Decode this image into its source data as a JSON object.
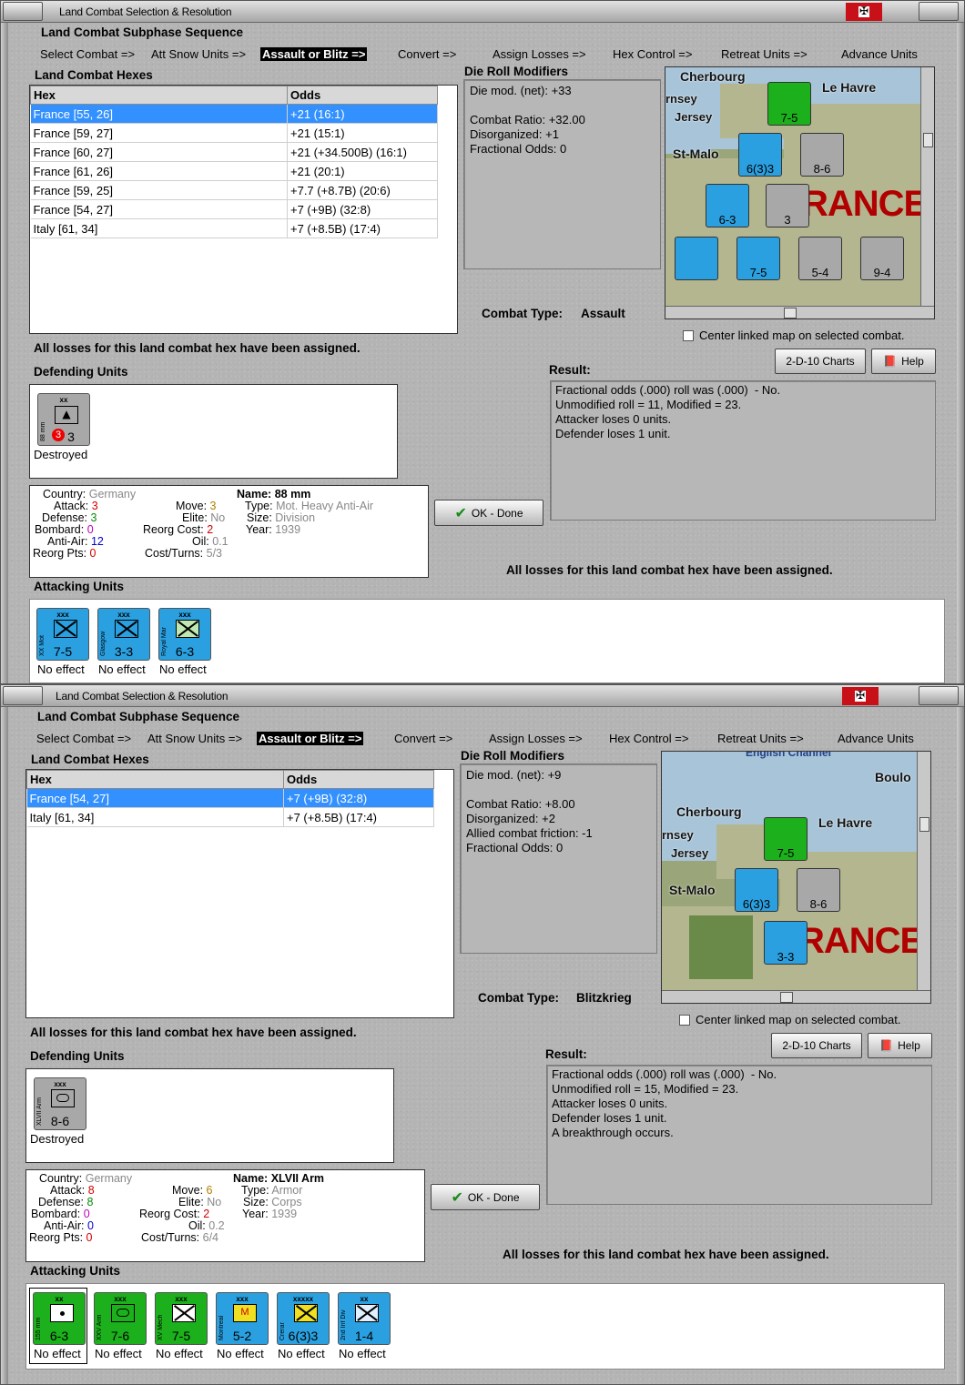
{
  "windows": [
    {
      "title": "Land Combat Selection & Resolution",
      "sequence_header": "Land Combat Subphase Sequence",
      "sequence": [
        "Select Combat =>",
        "Att Snow Units =>",
        "Assault or Blitz =>",
        "Convert =>",
        "Assign Losses =>",
        "Hex Control =>",
        "Retreat Units =>",
        "Advance Units"
      ],
      "hexes_header": "Land Combat Hexes",
      "hex_col": "Hex",
      "odds_col": "Odds",
      "hexes": [
        {
          "hex": "France [55, 26]",
          "odds": "+21 (16:1)"
        },
        {
          "hex": "France [59, 27]",
          "odds": "+21 (15:1)"
        },
        {
          "hex": "France [60, 27]",
          "odds": "+21 (+34.500B) (16:1)"
        },
        {
          "hex": "France [61, 26]",
          "odds": "+21 (20:1)"
        },
        {
          "hex": "France [59, 25]",
          "odds": "+7.7 (+8.7B) (20:6)"
        },
        {
          "hex": "France [54, 27]",
          "odds": "+7 (+9B) (32:8)"
        },
        {
          "hex": "Italy [61, 34]",
          "odds": "+7 (+8.5B) (17:4)"
        }
      ],
      "drm_header": "Die Roll Modifiers",
      "drm_text": "Die mod. (net): +33\n\nCombat Ratio: +32.00\nDisorganized: +1\nFractional Odds: 0",
      "combat_type_label": "Combat Type:",
      "combat_type": "Assault",
      "center_map": "Center linked map on selected combat.",
      "charts_btn": "2-D-10 Charts",
      "help_btn": "Help",
      "losses_msg": "All losses for this land combat hex have been assigned.",
      "defending_header": "Defending Units",
      "defender": {
        "top": "xx",
        "side": "88 mm",
        "value": "3",
        "badge": "3",
        "status": "Destroyed"
      },
      "result_header": "Result:",
      "result_text": "Fractional odds (.000) roll was (.000)  - No.\nUnmodified roll = 11, Modified = 23.\nAttacker loses 0 units.\nDefender loses 1 unit.",
      "ok_btn": "OK - Done",
      "info": {
        "country_k": "Country:",
        "country": "Germany",
        "attack_k": "Attack:",
        "attack": "3",
        "defense_k": "Defense:",
        "defense": "3",
        "bombard_k": "Bombard:",
        "bombard": "0",
        "antiair_k": "Anti-Air:",
        "antiair": "12",
        "reorgpts_k": "Reorg Pts:",
        "reorgpts": "0",
        "move_k": "Move:",
        "move": "3",
        "elite_k": "Elite:",
        "elite": "No",
        "reorgcost_k": "Reorg Cost:",
        "reorgcost": "2",
        "oil_k": "Oil:",
        "oil": "0.1",
        "costturns_k": "Cost/Turns:",
        "costturns": "5/3",
        "name_k": "Name:",
        "name": "88 mm",
        "type_k": "Type:",
        "type": "Mot. Heavy Anti-Air",
        "size_k": "Size:",
        "size": "Division",
        "year_k": "Year:",
        "year": "1939"
      },
      "attacking_header": "Attacking Units",
      "attackers": [
        {
          "top": "xxx",
          "side": "XX Mot",
          "value": "7-5",
          "status": "No effect",
          "color": "#2aa0e0"
        },
        {
          "top": "xxx",
          "side": "Glasgow",
          "value": "3-3",
          "status": "No effect",
          "color": "#2aa0e0"
        },
        {
          "top": "xxx",
          "side": "Royal Mar",
          "value": "6-3",
          "status": "No effect",
          "color": "#2aa0e0"
        }
      ],
      "map": {
        "labels": [
          "Cherbourg",
          "Le Havre",
          "Jersey",
          "rnsey",
          "St-Malo"
        ],
        "big": "RANCE"
      }
    },
    {
      "title": "Land Combat Selection & Resolution",
      "sequence_header": "Land Combat Subphase Sequence",
      "sequence": [
        "Select Combat =>",
        "Att Snow Units =>",
        "Assault or Blitz =>",
        "Convert =>",
        "Assign Losses =>",
        "Hex Control =>",
        "Retreat Units =>",
        "Advance Units"
      ],
      "hexes_header": "Land Combat Hexes",
      "hex_col": "Hex",
      "odds_col": "Odds",
      "hexes": [
        {
          "hex": "France [54, 27]",
          "odds": "+7 (+9B) (32:8)"
        },
        {
          "hex": "Italy [61, 34]",
          "odds": "+7 (+8.5B) (17:4)"
        }
      ],
      "drm_header": "Die Roll Modifiers",
      "drm_text": "Die mod. (net): +9\n\nCombat Ratio: +8.00\nDisorganized: +2\nAllied combat friction: -1\nFractional Odds: 0",
      "combat_type_label": "Combat Type:",
      "combat_type": "Blitzkrieg",
      "center_map": "Center linked map on selected combat.",
      "charts_btn": "2-D-10 Charts",
      "help_btn": "Help",
      "losses_msg": "All losses for this land combat hex have been assigned.",
      "defending_header": "Defending Units",
      "defender": {
        "top": "xxx",
        "side": "XLVII Arm",
        "value": "8-6",
        "badge": "",
        "status": "Destroyed"
      },
      "result_header": "Result:",
      "result_text": "Fractional odds (.000) roll was (.000)  - No.\nUnmodified roll = 15, Modified = 23.\nAttacker loses 0 units.\nDefender loses 1 unit.\nA breakthrough occurs.",
      "ok_btn": "OK - Done",
      "info": {
        "country_k": "Country:",
        "country": "Germany",
        "attack_k": "Attack:",
        "attack": "8",
        "defense_k": "Defense:",
        "defense": "8",
        "bombard_k": "Bombard:",
        "bombard": "0",
        "antiair_k": "Anti-Air:",
        "antiair": "0",
        "reorgpts_k": "Reorg Pts:",
        "reorgpts": "0",
        "move_k": "Move:",
        "move": "6",
        "elite_k": "Elite:",
        "elite": "No",
        "reorgcost_k": "Reorg Cost:",
        "reorgcost": "2",
        "oil_k": "Oil:",
        "oil": "0.2",
        "costturns_k": "Cost/Turns:",
        "costturns": "6/4",
        "name_k": "Name:",
        "name": "XLVII Arm",
        "type_k": "Type:",
        "type": "Armor",
        "size_k": "Size:",
        "size": "Corps",
        "year_k": "Year:",
        "year": "1939"
      },
      "attacking_header": "Attacking Units",
      "attackers": [
        {
          "top": "xx",
          "side": "155 mm",
          "value": "6-3",
          "status": "No effect",
          "color": "#1cb01c"
        },
        {
          "top": "xxx",
          "side": "XXV Arm",
          "value": "7-6",
          "status": "No effect",
          "color": "#1cb01c"
        },
        {
          "top": "xxx",
          "side": "XV Mech",
          "value": "7-5",
          "status": "No effect",
          "color": "#1cb01c"
        },
        {
          "top": "xxx",
          "side": "Montreal",
          "value": "5-2",
          "status": "No effect",
          "color": "#2aa0e0"
        },
        {
          "top": "xxxxx",
          "side": "Crerar",
          "value": "6(3)3",
          "status": "No effect",
          "color": "#2aa0e0"
        },
        {
          "top": "xx",
          "side": "2nd Inf Div",
          "value": "1-4",
          "status": "No effect",
          "color": "#2aa0e0"
        }
      ],
      "map": {
        "labels": [
          "English Channel",
          "Boulo",
          "Cherbourg",
          "Le Havre",
          "rnsey",
          "Jersey",
          "St-Malo"
        ],
        "big": "RANCE"
      }
    }
  ]
}
